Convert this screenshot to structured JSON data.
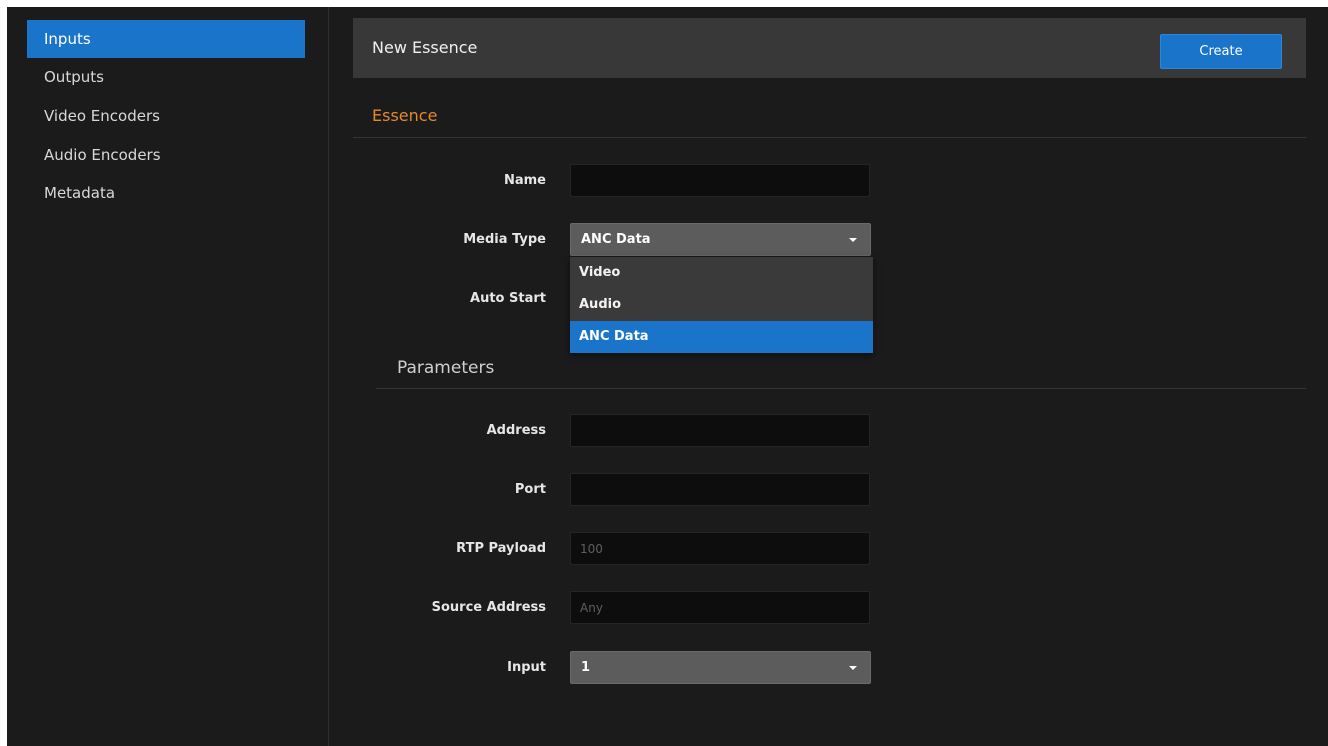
{
  "sidebar": {
    "items": [
      {
        "label": "Inputs",
        "active": true
      },
      {
        "label": "Outputs",
        "active": false
      },
      {
        "label": "Video Encoders",
        "active": false
      },
      {
        "label": "Audio Encoders",
        "active": false
      },
      {
        "label": "Metadata",
        "active": false
      }
    ]
  },
  "header": {
    "title": "New Essence",
    "create_label": "Create"
  },
  "essence": {
    "section_title": "Essence",
    "name_label": "Name",
    "name_value": "",
    "media_type_label": "Media Type",
    "media_type_value": "ANC Data",
    "media_type_options": [
      "Video",
      "Audio",
      "ANC Data"
    ],
    "auto_start_label": "Auto Start"
  },
  "parameters": {
    "section_title": "Parameters",
    "address_label": "Address",
    "address_value": "",
    "port_label": "Port",
    "port_value": "",
    "rtp_payload_label": "RTP Payload",
    "rtp_payload_placeholder": "100",
    "source_address_label": "Source Address",
    "source_address_placeholder": "Any",
    "input_label": "Input",
    "input_value": "1"
  },
  "colors": {
    "accent": "#1a74c9",
    "section_heading": "#e28a2c",
    "background": "#1b1b1b",
    "header_bar": "#383838"
  },
  "icons": {
    "select_caret": "caret-down-icon"
  }
}
